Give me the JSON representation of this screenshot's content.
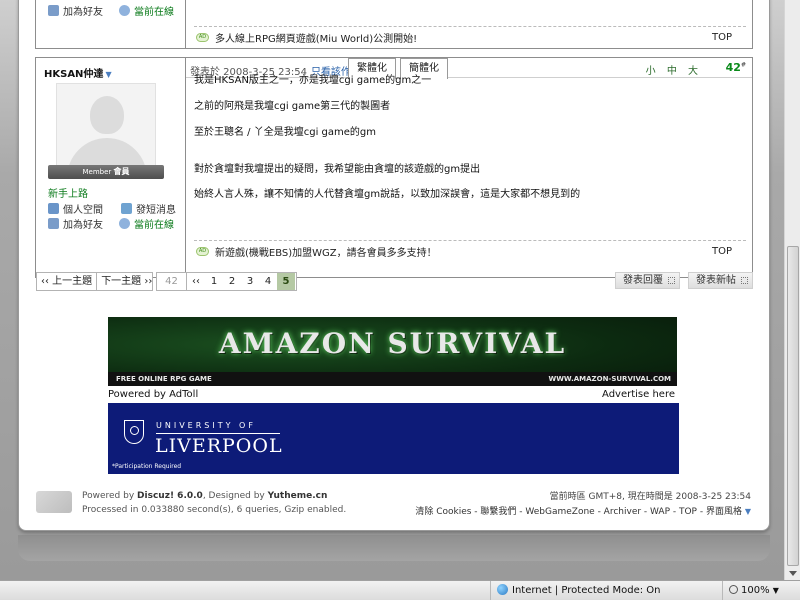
{
  "prev_post": {
    "add_friend": "加為好友",
    "online": "當前在線",
    "sig": "多人線上RPG網頁遊戲(Miu World)公測開始!",
    "top": "TOP"
  },
  "post": {
    "author": "HKSAN仲達",
    "member_label": "Member",
    "member_rank": "會員",
    "rank_title": "新手上路",
    "personal_space": "個人空間",
    "send_message": "發短消息",
    "add_friend": "加為好友",
    "online": "當前在線",
    "posted_at": "發表於 2008-3-25 23:54",
    "only_author": "只看該作者",
    "tab_traditional": "繁體化",
    "tab_simplified": "簡體化",
    "font_sizes": "小 中 大",
    "floor": "42",
    "floor_mark": "#",
    "lines": [
      "我是HKSAN版主之一，亦是我壇cgi game的gm之一",
      "之前的阿飛是我壇cgi game第三代的製圖者",
      "至於王聰名 / 丫全是我壇cgi game的gm",
      "對於貪壇對我壇提出的疑問，我希望能由貪壇的該遊戲的gm提出",
      "始終人言人殊，讓不知情的人代替貪壇gm說話，以致加深誤會，這是大家都不想見到的"
    ],
    "sig": "新遊戲(機戰EBS)加盟WGZ，請各會員多多支持！",
    "top": "TOP"
  },
  "pager": {
    "prev_topic": "‹‹ 上一主題",
    "next_topic": "下一主題 ››",
    "total": "42",
    "first": "‹‹",
    "pages": [
      "1",
      "2",
      "3",
      "4"
    ],
    "current": "5",
    "reply": "發表回覆",
    "new_topic": "發表新帖"
  },
  "ads": {
    "banner1_title": "AMAZON SURVIVAL",
    "banner1_sub": "FREE ONLINE RPG GAME",
    "banner1_url": "WWW.AMAZON-SURVIVAL.COM",
    "powered_by": "Powered by AdToll",
    "advertise_here": "Advertise here",
    "banner2_univ_of": "UNIVERSITY OF",
    "banner2_name": "LIVERPOOL",
    "banner2_note": "*Participation Required"
  },
  "footer": {
    "powered_prefix": "Powered by",
    "powered_name": "Discuz! 6.0.0",
    "designed_prefix": ", Designed by",
    "designer": "Yutheme.cn",
    "processed": "Processed in 0.033880 second(s), 6 queries, Gzip enabled.",
    "time_info": "當前時區 GMT+8, 現在時間是 2008-3-25 23:54",
    "links": "清除 Cookies - 聯繫我們 - WebGameZone - Archiver - WAP - TOP - 界面風格"
  },
  "statusbar": {
    "zone": "Internet | Protected Mode: On",
    "zoom": "100%"
  }
}
